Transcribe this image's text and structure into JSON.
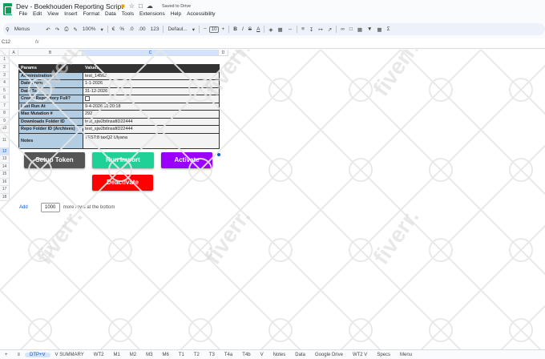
{
  "window": {
    "title": "Dev - Boekhouden Reporting Script",
    "saved_status": "Saved to Drive"
  },
  "menu": [
    "File",
    "Edit",
    "View",
    "Insert",
    "Format",
    "Data",
    "Tools",
    "Extensions",
    "Help",
    "Accessibility"
  ],
  "toolbar": {
    "search_label": "Menus",
    "zoom": "100%",
    "currency": "€",
    "percent": "%",
    "decimal_dec": ".0",
    "decimal_inc": ".00",
    "number_format": "123",
    "font": "Defaul...",
    "font_size": "10",
    "bold": "B",
    "italic": "I",
    "strike": "S",
    "text_color": "A"
  },
  "formula_bar": {
    "name_box": "C12",
    "fx": "fx"
  },
  "columns": [
    "A",
    "B",
    "C",
    "D"
  ],
  "rows": [
    "1",
    "2",
    "3",
    "4",
    "5",
    "6",
    "7",
    "8",
    "9",
    "10",
    "11",
    "12",
    "13",
    "14",
    "15",
    "16",
    "17",
    "18"
  ],
  "params_table": {
    "header": [
      "Params",
      "Values"
    ],
    "rows": [
      {
        "key": "Administration #",
        "value": "test_14562"
      },
      {
        "key": "Date From",
        "value": "1-1-2026"
      },
      {
        "key": "Date To",
        "value": "31-12-2026"
      },
      {
        "key": "Create Repository Full?",
        "value": ""
      },
      {
        "key": "Last Run At",
        "value": "9-4-2026 11:20:18"
      },
      {
        "key": "Max Mutation #",
        "value": "292"
      },
      {
        "key": "Downloads Folder ID",
        "value": "test_sjw2btlnsafiD22444"
      },
      {
        "key": "Repo Folder ID  (Archives)",
        "value": "test_sjw2btlnsafiD22444"
      },
      {
        "key": "Notes",
        "value": "TEST:8 taxQ2 Ulyana"
      }
    ]
  },
  "buttons": {
    "setup_token": "Setup Token",
    "run_import": "Run Import",
    "activate": "Activate",
    "deactivate": "Deactivate"
  },
  "colors": {
    "setup_token": "#555555",
    "run_import": "#1fd196",
    "activate": "#9b00ff",
    "deactivate": "#ff0000"
  },
  "add_rows": {
    "link": "Add",
    "count": "1000",
    "suffix": "more rows at the bottom"
  },
  "watermark_text": "fiverr.",
  "tabs": [
    "DTP+V",
    "V SUMMARY",
    "WT2",
    "M1",
    "M2",
    "M3",
    "M6",
    "T1",
    "T2",
    "T3",
    "T4a",
    "T4b",
    "V",
    "Notes",
    "Data",
    "Google Drive",
    "WT2 V",
    "Specs",
    "Menu"
  ]
}
